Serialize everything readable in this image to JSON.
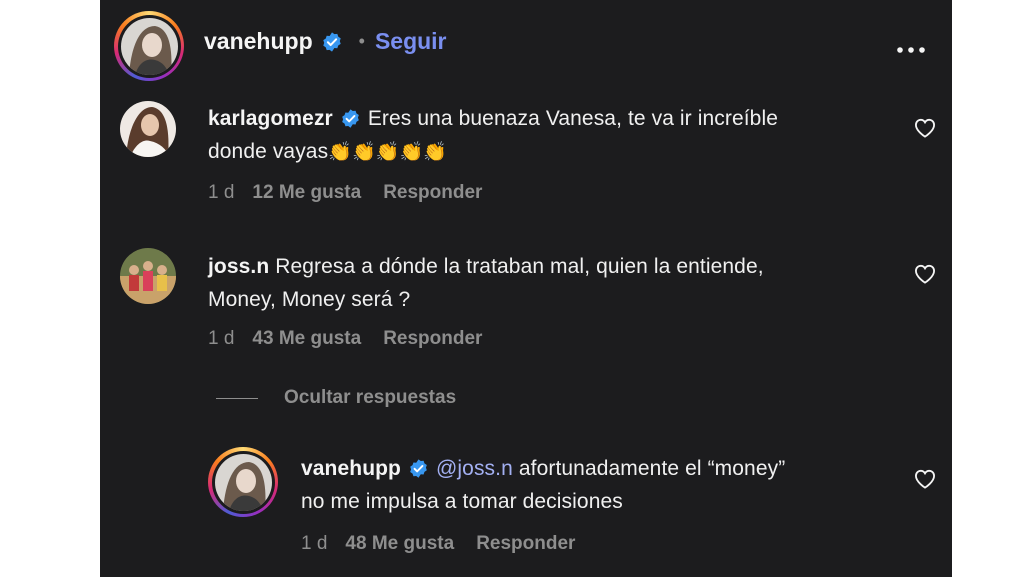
{
  "post_header": {
    "username": "vanehupp",
    "separator": "•",
    "follow_label": "Seguir"
  },
  "comments": [
    {
      "username": "karlagomezr",
      "text_line1": "Eres una buenaza Vanesa, te va ir increíble",
      "text_line2": "donde vayas",
      "emoji": "👏👏👏👏👏",
      "time": "1 d",
      "likes": "12 Me gusta",
      "reply_label": "Responder"
    },
    {
      "username": "joss.n",
      "text_line1": "Regresa a dónde la trataban mal, quien la entiende,",
      "text_line2": "Money, Money será ?",
      "time": "1 d",
      "likes": "43 Me gusta",
      "reply_label": "Responder"
    }
  ],
  "hide_replies_label": "Ocultar respuestas",
  "reply": {
    "username": "vanehupp",
    "mention": "@joss.n",
    "text_line1": "afortunadamente el “money”",
    "text_line2": "no me impulsa a tomar decisiones",
    "time": "1 d",
    "likes": "48 Me gusta",
    "reply_label": "Responder"
  },
  "colors": {
    "panel_bg": "#1c1c1e",
    "verified_blue": "#3897f0",
    "link_blue": "#7a8ff0",
    "muted_text": "#8e8e8e"
  }
}
